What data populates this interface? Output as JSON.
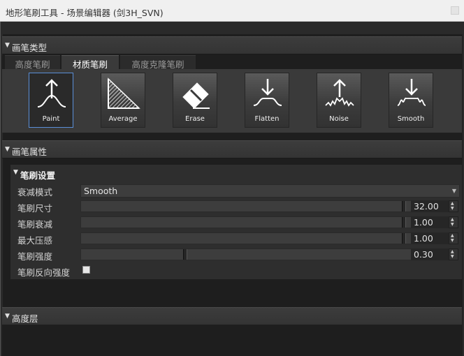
{
  "window": {
    "title": "地形笔刷工具 - 场景编辑器 (剑3H_SVN)"
  },
  "sections": {
    "brush_type": {
      "label": "画笔类型"
    },
    "brush_props": {
      "label": "画笔属性"
    },
    "height_layer": {
      "label": "高度层"
    }
  },
  "tabs": [
    {
      "label": "高度笔刷"
    },
    {
      "label": "材质笔刷"
    },
    {
      "label": "高度克隆笔刷"
    }
  ],
  "brushes": [
    {
      "label": "Paint",
      "icon": "paint-icon"
    },
    {
      "label": "Average",
      "icon": "average-icon"
    },
    {
      "label": "Erase",
      "icon": "eraser-icon"
    },
    {
      "label": "Flatten",
      "icon": "flatten-icon"
    },
    {
      "label": "Noise",
      "icon": "noise-icon"
    },
    {
      "label": "Smooth",
      "icon": "smooth-icon"
    }
  ],
  "brush_settings": {
    "label": "笔刷设置",
    "falloff": {
      "label": "衰减模式",
      "value": "Smooth"
    },
    "size": {
      "label": "笔刷尺寸",
      "value": "32.00",
      "fraction": 0.94
    },
    "decay": {
      "label": "笔刷衰减",
      "value": "1.00",
      "fraction": 0.94
    },
    "max_pressure": {
      "label": "最大压感",
      "value": "1.00",
      "fraction": 0.94
    },
    "strength": {
      "label": "笔刷强度",
      "value": "0.30",
      "fraction": 0.3
    },
    "invert": {
      "label": "笔刷反向强度",
      "checked": false
    }
  }
}
